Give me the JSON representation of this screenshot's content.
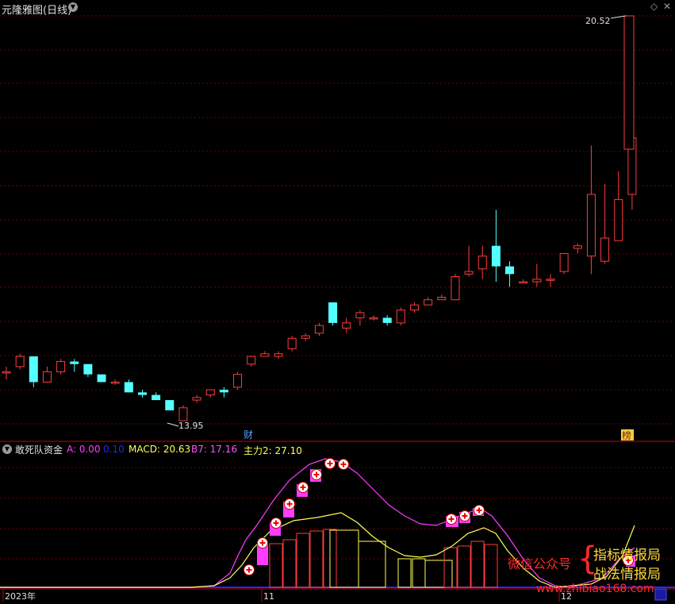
{
  "header": {
    "title": "元隆雅图(日线)",
    "colors": {
      "title": "#e0e0e0",
      "up": "#ff3c3c",
      "down": "#54ffff",
      "grid": "#6e0000",
      "axis": "#c80000"
    }
  },
  "price_chart": {
    "candles": [
      [
        14.3,
        14.4,
        14.15,
        14.3
      ],
      [
        14.4,
        14.65,
        14.35,
        14.6
      ],
      [
        14.6,
        14.6,
        14.0,
        14.1
      ],
      [
        14.1,
        14.4,
        14.1,
        14.3
      ],
      [
        14.3,
        14.55,
        14.25,
        14.5
      ],
      [
        14.5,
        14.55,
        14.3,
        14.45
      ],
      [
        14.45,
        14.45,
        14.2,
        14.25
      ],
      [
        14.25,
        14.25,
        14.1,
        14.1
      ],
      [
        14.1,
        14.15,
        14.05,
        14.1
      ],
      [
        14.1,
        14.15,
        13.9,
        13.9
      ],
      [
        13.9,
        13.95,
        13.8,
        13.85
      ],
      [
        13.85,
        13.9,
        13.75,
        13.75
      ],
      [
        13.75,
        13.75,
        13.55,
        13.55
      ],
      [
        13.35,
        13.65,
        13.35,
        13.6
      ],
      [
        13.75,
        13.85,
        13.7,
        13.8
      ],
      [
        13.85,
        13.95,
        13.8,
        13.95
      ],
      [
        13.95,
        14.0,
        13.8,
        13.9
      ],
      [
        14.0,
        14.3,
        13.95,
        14.25
      ],
      [
        14.45,
        14.6,
        14.4,
        14.6
      ],
      [
        14.6,
        14.7,
        14.6,
        14.65
      ],
      [
        14.6,
        14.7,
        14.55,
        14.65
      ],
      [
        14.75,
        15.0,
        14.7,
        14.95
      ],
      [
        14.95,
        15.05,
        14.9,
        15.0
      ],
      [
        15.05,
        15.25,
        15.0,
        15.2
      ],
      [
        15.65,
        15.65,
        15.2,
        15.25
      ],
      [
        15.15,
        15.35,
        15.05,
        15.25
      ],
      [
        15.35,
        15.5,
        15.2,
        15.45
      ],
      [
        15.35,
        15.4,
        15.3,
        15.35
      ],
      [
        15.35,
        15.4,
        15.2,
        15.25
      ],
      [
        15.25,
        15.55,
        15.2,
        15.5
      ],
      [
        15.5,
        15.65,
        15.45,
        15.6
      ],
      [
        15.6,
        15.75,
        15.6,
        15.7
      ],
      [
        15.7,
        15.8,
        15.7,
        15.75
      ],
      [
        15.7,
        16.2,
        15.7,
        16.15
      ],
      [
        16.2,
        16.75,
        16.15,
        16.25
      ],
      [
        16.3,
        16.75,
        16.1,
        16.55
      ],
      [
        16.75,
        17.45,
        16.05,
        16.35
      ],
      [
        16.35,
        16.45,
        15.95,
        16.2
      ],
      [
        16.05,
        16.1,
        16.05,
        16.05
      ],
      [
        16.05,
        16.4,
        15.95,
        16.1
      ],
      [
        16.1,
        16.2,
        15.95,
        16.1
      ],
      [
        16.25,
        16.55,
        16.2,
        16.6
      ],
      [
        16.7,
        16.8,
        16.6,
        16.75
      ],
      [
        16.55,
        18.7,
        16.2,
        17.75
      ],
      [
        16.45,
        17.95,
        16.4,
        16.9
      ],
      [
        16.85,
        18.2,
        16.85,
        17.65
      ],
      [
        17.75,
        19.6,
        17.45,
        18.85
      ]
    ],
    "high_marker": {
      "label": "20.52"
    },
    "low_marker": {
      "label": "13.95"
    },
    "event_badges": [
      {
        "label": "财"
      },
      {
        "label": "榜"
      }
    ]
  },
  "indicator": {
    "name": "敢死队资金",
    "fields": [
      {
        "text": "A: 0.00",
        "color": "#ff3cff"
      },
      {
        "text": "0.10",
        "color": "#2424ff"
      },
      {
        "text": "MACD: 20.63",
        "color": "#ffff54"
      },
      {
        "text": "B7: 17.16",
        "color": "#ff54ff"
      },
      {
        "text": "主力2: 27.10",
        "color": "#ffff54"
      }
    ]
  },
  "x_axis": {
    "labels": [
      {
        "text": "2023年"
      },
      {
        "text": "11"
      },
      {
        "text": "12"
      }
    ]
  },
  "watermark": {
    "left": "微信公众号",
    "right_top": "指标情报局",
    "right_bottom": "战法情报局",
    "site": "www.zhibiao168.com"
  }
}
